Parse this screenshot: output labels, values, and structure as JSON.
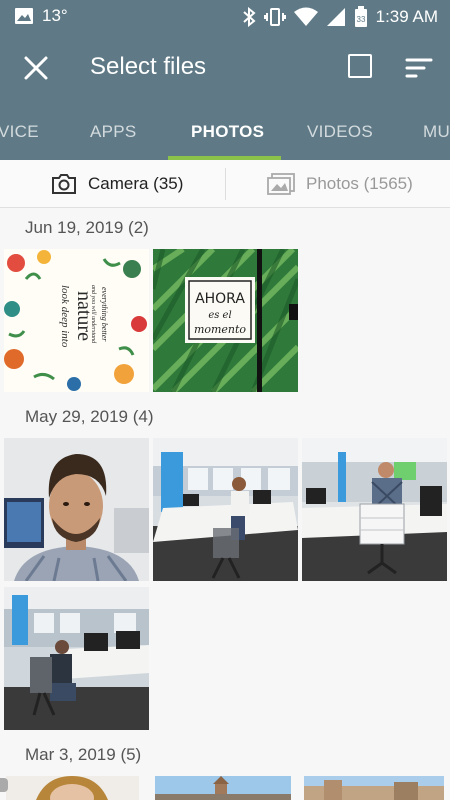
{
  "status": {
    "temperature": "13°",
    "time": "1:39 AM",
    "icons": [
      "image-icon",
      "bluetooth-icon",
      "vibrate-icon",
      "wifi-icon",
      "signal-icon",
      "battery-icon"
    ]
  },
  "appbar": {
    "title": "Select files",
    "close_icon": "close-icon",
    "select_all_icon": "checkbox-icon",
    "sort_icon": "sort-icon"
  },
  "tabs": [
    {
      "label": "VICE",
      "active": false
    },
    {
      "label": "APPS",
      "active": false
    },
    {
      "label": "PHOTOS",
      "active": true
    },
    {
      "label": "VIDEOS",
      "active": false
    },
    {
      "label": "MU",
      "active": false
    }
  ],
  "filters": {
    "camera": {
      "label": "Camera (35)",
      "icon": "camera-icon"
    },
    "photos": {
      "label": "Photos (1565)",
      "icon": "photos-icon"
    }
  },
  "sections": [
    {
      "label": "Jun 19, 2019 (2)"
    },
    {
      "label": "May 29, 2019 (4)"
    },
    {
      "label": "Mar 3, 2019 (5)"
    }
  ],
  "photo_text": {
    "nature_line1": "look deep into",
    "nature_line2": "nature",
    "nature_line3": "and you will understand",
    "nature_line4": "everything better",
    "ahora_line1": "AHORA",
    "ahora_line2": "es el",
    "ahora_line3": "momento"
  },
  "colors": {
    "toolbar": "#5f7a86",
    "accent": "#8bc34a",
    "background": "#f7f7f7"
  }
}
